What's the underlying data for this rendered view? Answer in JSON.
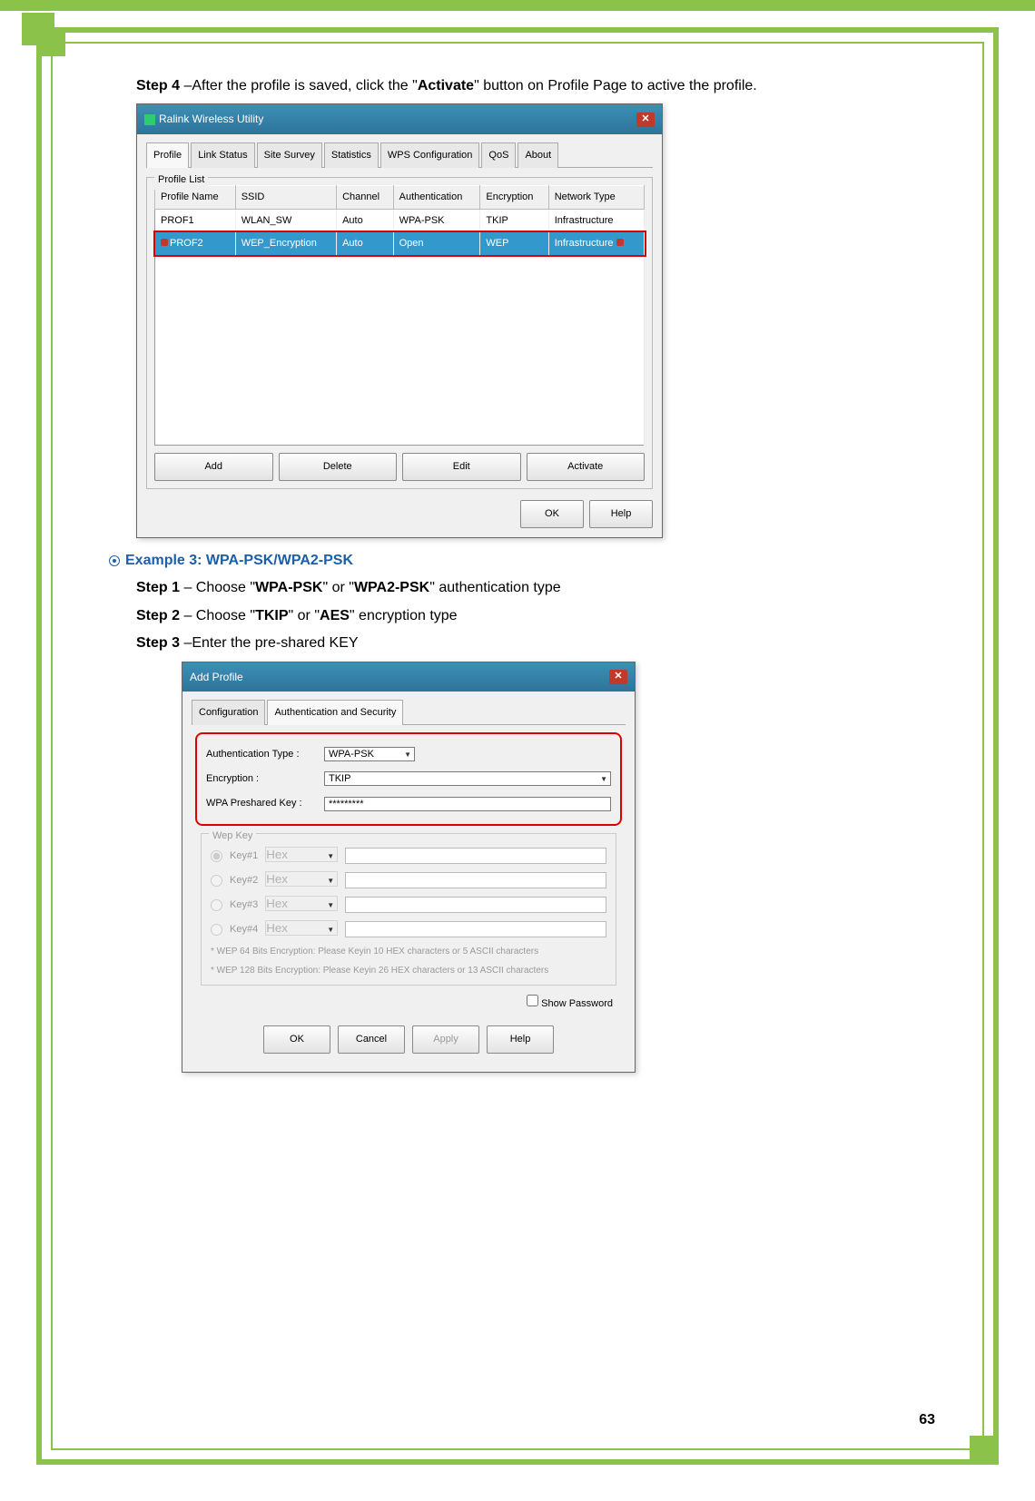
{
  "intro": {
    "step4_label": "Step 4",
    "step4_text_prefix": " –After the profile is saved, click the \"",
    "step4_bold": "Activate",
    "step4_text_suffix": "\" button on Profile Page to active the profile."
  },
  "win1": {
    "title": "Ralink Wireless Utility",
    "tabs": [
      "Profile",
      "Link Status",
      "Site Survey",
      "Statistics",
      "WPS Configuration",
      "QoS",
      "About"
    ],
    "group": "Profile List",
    "headers": [
      "Profile Name",
      "SSID",
      "Channel",
      "Authentication",
      "Encryption",
      "Network Type"
    ],
    "rows": [
      {
        "name": "PROF1",
        "ssid": "WLAN_SW",
        "channel": "Auto",
        "auth": "WPA-PSK",
        "enc": "TKIP",
        "nettype": "Infrastructure",
        "selected": false
      },
      {
        "name": "PROF2",
        "ssid": "WEP_Encryption",
        "channel": "Auto",
        "auth": "Open",
        "enc": "WEP",
        "nettype": "Infrastructure",
        "selected": true
      }
    ],
    "buttons": [
      "Add",
      "Delete",
      "Edit",
      "Activate"
    ],
    "ok": "OK",
    "help": "Help"
  },
  "example_heading": "Example 3: WPA-PSK/WPA2-PSK",
  "step1_label": "Step 1",
  "step1_prefix": " – Choose \"",
  "step1_b1": "WPA-PSK",
  "step1_mid": "\" or \"",
  "step1_b2": "WPA2-PSK",
  "step1_suffix": "\" authentication type",
  "step2_label": "Step 2",
  "step2_prefix": " – Choose \"",
  "step2_b1": "TKIP",
  "step2_mid": "\" or \"",
  "step2_b2": "AES",
  "step2_suffix": "\" encryption type",
  "step3_label": "Step 3",
  "step3_text": " –Enter the pre-shared KEY",
  "win2": {
    "title": "Add Profile",
    "tabs": [
      "Configuration",
      "Authentication and Security"
    ],
    "auth_type_label": "Authentication Type :",
    "auth_type_value": "WPA-PSK",
    "enc_label": "Encryption :",
    "enc_value": "TKIP",
    "psk_label": "WPA Preshared Key :",
    "psk_value": "*********",
    "wep_group": "Wep Key",
    "wep_keys": [
      {
        "label": "Key#1",
        "format": "Hex",
        "checked": true
      },
      {
        "label": "Key#2",
        "format": "Hex",
        "checked": false
      },
      {
        "label": "Key#3",
        "format": "Hex",
        "checked": false
      },
      {
        "label": "Key#4",
        "format": "Hex",
        "checked": false
      }
    ],
    "note1": "* WEP 64 Bits Encryption:  Please Keyin 10 HEX characters or 5 ASCII characters",
    "note2": "* WEP 128 Bits Encryption:  Please Keyin 26 HEX characters or 13 ASCII characters",
    "show_pw": "Show Password",
    "buttons": {
      "ok": "OK",
      "cancel": "Cancel",
      "apply": "Apply",
      "help": "Help"
    }
  },
  "page_number": "63"
}
